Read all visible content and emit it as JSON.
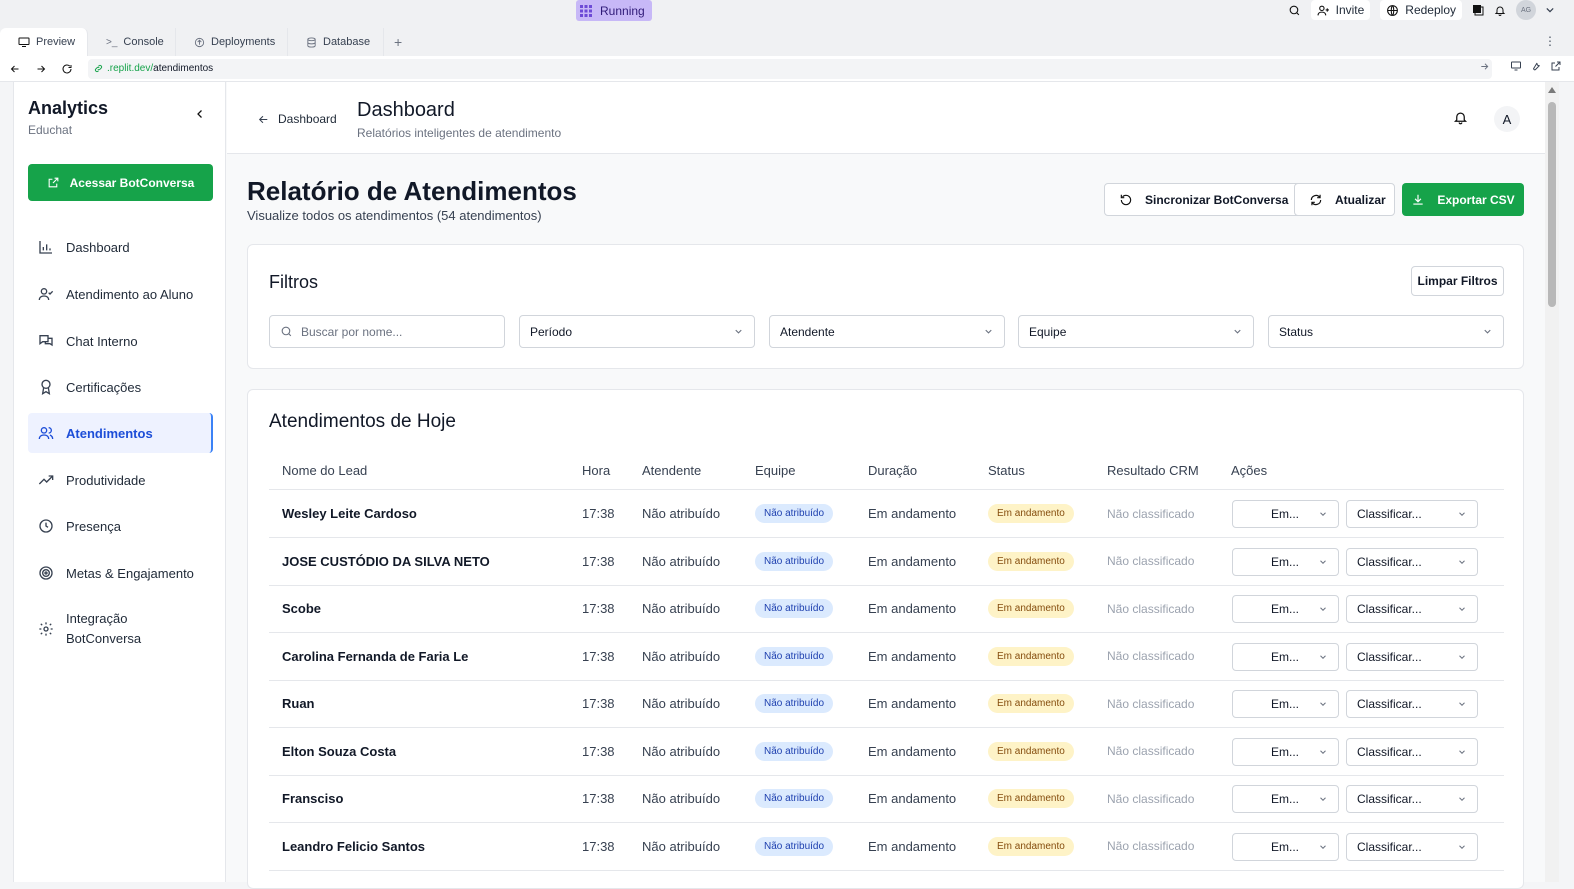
{
  "replit": {
    "status": "Running",
    "invite": "Invite",
    "redeploy": "Redeploy",
    "avatar_initials": "AG"
  },
  "tabs": [
    "Preview",
    "Console",
    "Deployments",
    "Database"
  ],
  "url": {
    "host": ".replit.dev/",
    "path": "atendimentos"
  },
  "sidebar": {
    "title": "Analytics",
    "subtitle": "Educhat",
    "cta": "Acessar BotConversa",
    "items": [
      {
        "label": "Dashboard",
        "icon": "bar-chart-icon"
      },
      {
        "label": "Atendimento ao Aluno",
        "icon": "user-check-icon"
      },
      {
        "label": "Chat Interno",
        "icon": "chat-icon"
      },
      {
        "label": "Certificações",
        "icon": "award-icon"
      },
      {
        "label": "Atendimentos",
        "icon": "users-icon",
        "active": true
      },
      {
        "label": "Produtividade",
        "icon": "trending-up-icon"
      },
      {
        "label": "Presença",
        "icon": "clock-icon"
      },
      {
        "label": "Metas & Engajamento",
        "icon": "target-icon"
      },
      {
        "label": "Integração\nBotConversa",
        "label_line1": "Integração",
        "label_line2": "BotConversa",
        "icon": "settings-icon"
      }
    ]
  },
  "header": {
    "back": "Dashboard",
    "title": "Dashboard",
    "subtitle": "Relatórios inteligentes de atendimento",
    "avatar": "A"
  },
  "report": {
    "title": "Relatório de Atendimentos",
    "subtitle": "Visualize todos os atendimentos (54 atendimentos)",
    "sync": "Sincronizar BotConversa",
    "refresh": "Atualizar",
    "export": "Exportar CSV"
  },
  "filters": {
    "title": "Filtros",
    "clear": "Limpar Filtros",
    "search_placeholder": "Buscar por nome...",
    "period": "Período",
    "attendant": "Atendente",
    "team": "Equipe",
    "status": "Status"
  },
  "table": {
    "title": "Atendimentos de Hoje",
    "columns": [
      "Nome do Lead",
      "Hora",
      "Atendente",
      "Equipe",
      "Duração",
      "Status",
      "Resultado CRM",
      "Ações"
    ],
    "rows": [
      {
        "name": "Wesley Leite Cardoso",
        "hora": "17:38",
        "atendente": "Não atribuído",
        "equipe": "Não atribuído",
        "duracao": "Em andamento",
        "status": "Em andamento",
        "crm": "Não classificado",
        "acao_status": "Em...",
        "acao_class": "Classificar..."
      },
      {
        "name": "JOSE CUSTÓDIO DA SILVA NETO",
        "hora": "17:38",
        "atendente": "Não atribuído",
        "equipe": "Não atribuído",
        "duracao": "Em andamento",
        "status": "Em andamento",
        "crm": "Não classificado",
        "acao_status": "Em...",
        "acao_class": "Classificar..."
      },
      {
        "name": "Scobe",
        "hora": "17:38",
        "atendente": "Não atribuído",
        "equipe": "Não atribuído",
        "duracao": "Em andamento",
        "status": "Em andamento",
        "crm": "Não classificado",
        "acao_status": "Em...",
        "acao_class": "Classificar..."
      },
      {
        "name": "Carolina Fernanda de Faria Le",
        "hora": "17:38",
        "atendente": "Não atribuído",
        "equipe": "Não atribuído",
        "duracao": "Em andamento",
        "status": "Em andamento",
        "crm": "Não classificado",
        "acao_status": "Em...",
        "acao_class": "Classificar..."
      },
      {
        "name": "Ruan",
        "hora": "17:38",
        "atendente": "Não atribuído",
        "equipe": "Não atribuído",
        "duracao": "Em andamento",
        "status": "Em andamento",
        "crm": "Não classificado",
        "acao_status": "Em...",
        "acao_class": "Classificar..."
      },
      {
        "name": "Elton Souza Costa",
        "hora": "17:38",
        "atendente": "Não atribuído",
        "equipe": "Não atribuído",
        "duracao": "Em andamento",
        "status": "Em andamento",
        "crm": "Não classificado",
        "acao_status": "Em...",
        "acao_class": "Classificar..."
      },
      {
        "name": "Fransciso",
        "hora": "17:38",
        "atendente": "Não atribuído",
        "equipe": "Não atribuído",
        "duracao": "Em andamento",
        "status": "Em andamento",
        "crm": "Não classificado",
        "acao_status": "Em...",
        "acao_class": "Classificar..."
      },
      {
        "name": "Leandro Felicio Santos",
        "hora": "17:38",
        "atendente": "Não atribuído",
        "equipe": "Não atribuído",
        "duracao": "Em andamento",
        "status": "Em andamento",
        "crm": "Não classificado",
        "acao_status": "Em...",
        "acao_class": "Classificar..."
      }
    ]
  },
  "colors": {
    "primary_green": "#16a34a",
    "active_blue": "#1d4ed8",
    "replit_running": "#c7b8f7"
  }
}
